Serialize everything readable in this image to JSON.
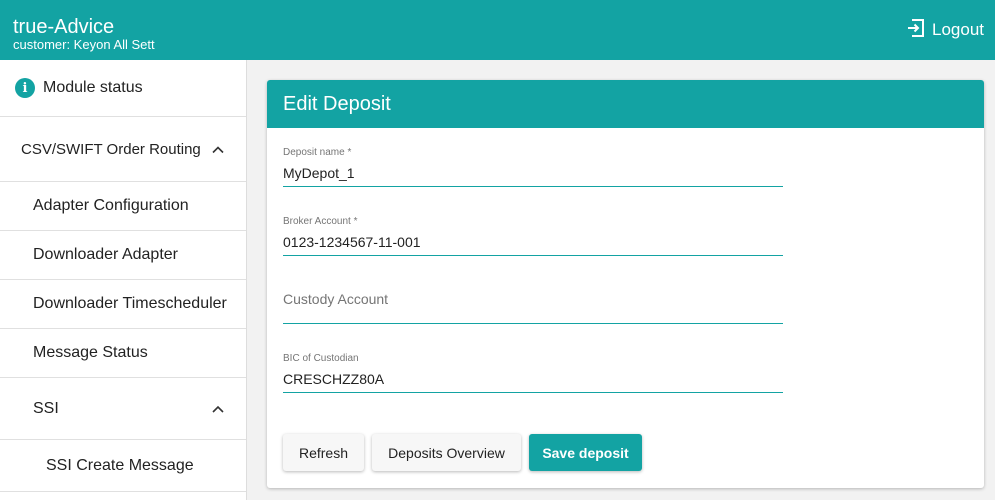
{
  "header": {
    "app_title": "true-Advice",
    "customer": "customer: Keyon All Sett",
    "logout_label": "Logout"
  },
  "sidebar": {
    "module_status": "Module status",
    "sections": [
      {
        "label": "CSV/SWIFT Order Routing",
        "expanded": true
      },
      {
        "label": "SSI",
        "expanded": true
      }
    ],
    "items": [
      "Adapter Configuration",
      "Downloader Adapter",
      "Downloader Timescheduler",
      "Message Status"
    ],
    "ssi_items": [
      "SSI Create Message"
    ]
  },
  "form": {
    "title": "Edit Deposit",
    "fields": [
      {
        "label": "Deposit name *",
        "value": "MyDepot_1",
        "placeholder": ""
      },
      {
        "label": "Broker Account *",
        "value": "0123-1234567-11-001",
        "placeholder": ""
      },
      {
        "label": "",
        "value": "",
        "placeholder": "Custody Account"
      },
      {
        "label": "BIC of Custodian",
        "value": "CRESCHZZ80A",
        "placeholder": ""
      }
    ],
    "buttons": {
      "refresh": "Refresh",
      "overview": "Deposits Overview",
      "save": "Save deposit"
    }
  },
  "colors": {
    "accent": "#13a3a3"
  }
}
